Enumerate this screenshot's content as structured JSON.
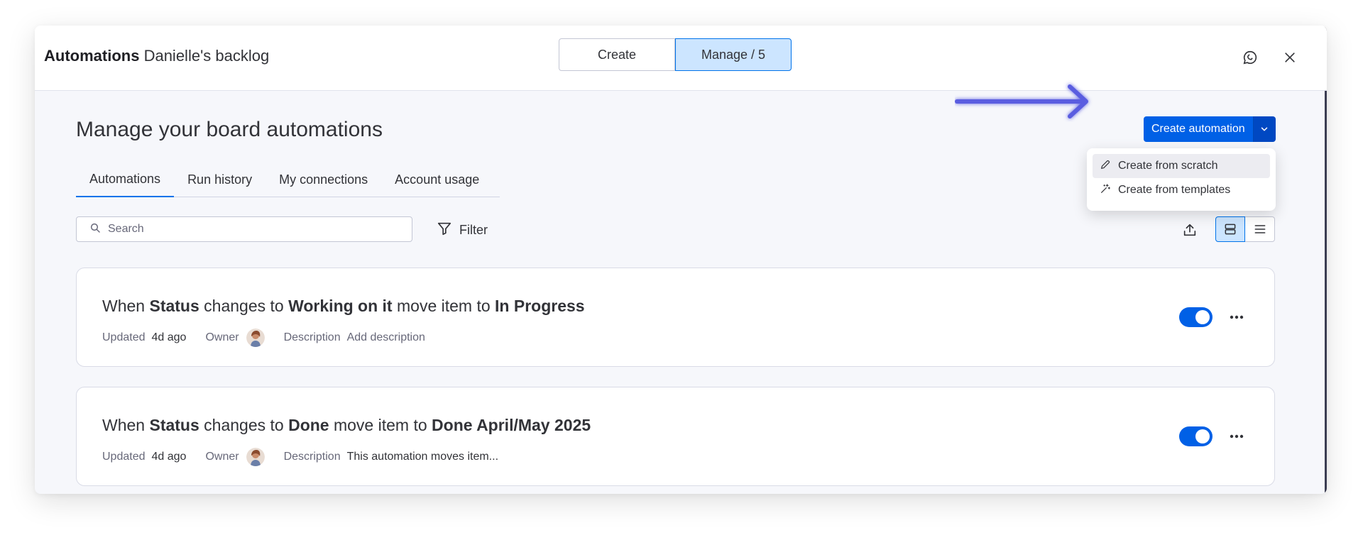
{
  "header": {
    "app_title": "Automations",
    "board_name": "Danielle's backlog",
    "tabs": [
      {
        "label": "Create",
        "selected": false
      },
      {
        "label": "Manage / 5",
        "selected": true
      }
    ],
    "icons": [
      "feedback-icon",
      "close-icon"
    ]
  },
  "main": {
    "page_title": "Manage your board automations",
    "tabs": [
      {
        "label": "Automations",
        "active": true
      },
      {
        "label": "Run history",
        "active": false
      },
      {
        "label": "My connections",
        "active": false
      },
      {
        "label": "Account usage",
        "active": false
      }
    ],
    "search": {
      "placeholder": "Search",
      "value": ""
    },
    "filter_label": "Filter",
    "create_button": {
      "label": "Create automation"
    },
    "create_menu": [
      {
        "label": "Create from scratch",
        "icon": "pencil-icon"
      },
      {
        "label": "Create from templates",
        "icon": "magic-wand-icon"
      }
    ],
    "automations": [
      {
        "parts": [
          "When ",
          "Status",
          " changes to ",
          "Working on it",
          " move item to ",
          "In Progress"
        ],
        "updated_label": "Updated",
        "updated_value": "4d ago",
        "owner_label": "Owner",
        "description_label": "Description",
        "description_value": "Add description",
        "enabled": true
      },
      {
        "parts": [
          "When ",
          "Status",
          " changes to ",
          "Done",
          " move item to ",
          "Done April/May 2025"
        ],
        "updated_label": "Updated",
        "updated_value": "4d ago",
        "owner_label": "Owner",
        "description_label": "Description",
        "description_value": "This automation moves item...",
        "enabled": true
      }
    ]
  },
  "colors": {
    "primary": "#0060e6",
    "selected_bg": "#cce5ff",
    "annotation_arrow": "#5a5de0",
    "modal_bg": "#f6f7fb"
  }
}
